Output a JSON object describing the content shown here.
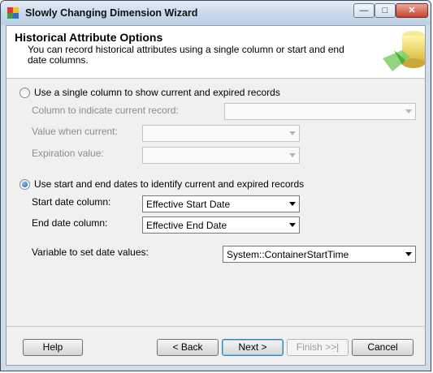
{
  "window": {
    "title": "Slowly Changing Dimension Wizard"
  },
  "header": {
    "title": "Historical Attribute Options",
    "description": "You can record historical attributes using a single column or start and end date columns."
  },
  "option_single": {
    "label": "Use a single column to show current and expired records",
    "selected": false,
    "column_label": "Column to indicate current record:",
    "column_value": "",
    "current_label": "Value when current:",
    "current_value": "",
    "expiration_label": "Expiration value:",
    "expiration_value": ""
  },
  "option_dates": {
    "label": "Use start and end dates to identify current and expired records",
    "selected": true,
    "start_label": "Start date column:",
    "start_value": "Effective Start Date",
    "end_label": "End date column:",
    "end_value": "Effective End Date",
    "variable_label": "Variable to set date values:",
    "variable_value": "System::ContainerStartTime"
  },
  "buttons": {
    "help": "Help",
    "back": "< Back",
    "next": "Next >",
    "finish": "Finish >>|",
    "cancel": "Cancel"
  }
}
